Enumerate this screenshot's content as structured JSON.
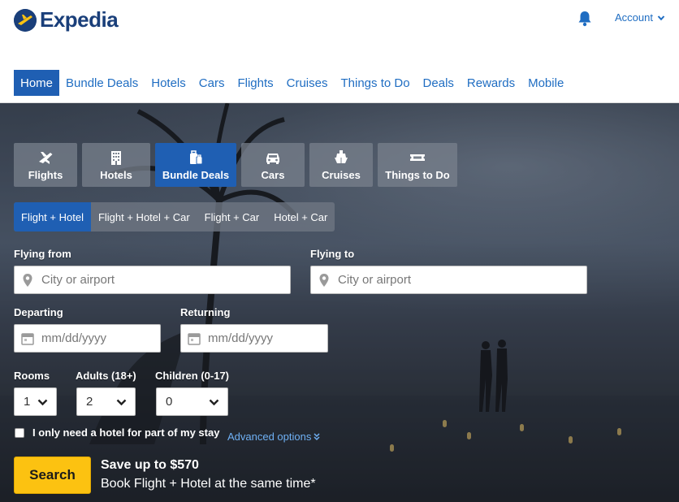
{
  "header": {
    "logo_text": "Expedia",
    "account_label": "Account"
  },
  "nav": {
    "items": [
      {
        "label": "Home"
      },
      {
        "label": "Bundle Deals"
      },
      {
        "label": "Hotels"
      },
      {
        "label": "Cars"
      },
      {
        "label": "Flights"
      },
      {
        "label": "Cruises"
      },
      {
        "label": "Things to Do"
      },
      {
        "label": "Deals"
      },
      {
        "label": "Rewards"
      },
      {
        "label": "Mobile"
      }
    ],
    "active": "Home"
  },
  "product_tabs": [
    {
      "label": "Flights",
      "icon": "plane-icon"
    },
    {
      "label": "Hotels",
      "icon": "hotel-building-icon"
    },
    {
      "label": "Bundle Deals",
      "icon": "bundle-luggage-icon"
    },
    {
      "label": "Cars",
      "icon": "car-icon"
    },
    {
      "label": "Cruises",
      "icon": "ship-icon"
    },
    {
      "label": "Things to Do",
      "icon": "ticket-icon"
    }
  ],
  "active_product_tab": "Bundle Deals",
  "sub_tabs": [
    {
      "label": "Flight + Hotel"
    },
    {
      "label": "Flight + Hotel + Car"
    },
    {
      "label": "Flight + Car"
    },
    {
      "label": "Hotel + Car"
    }
  ],
  "active_sub_tab": "Flight + Hotel",
  "form": {
    "flying_from_label": "Flying from",
    "flying_from_placeholder": "City or airport",
    "flying_to_label": "Flying to",
    "flying_to_placeholder": "City or airport",
    "departing_label": "Departing",
    "departing_placeholder": "mm/dd/yyyy",
    "returning_label": "Returning",
    "returning_placeholder": "mm/dd/yyyy",
    "rooms_label": "Rooms",
    "rooms_value": "1",
    "adults_label": "Adults (18+)",
    "adults_value": "2",
    "children_label": "Children (0-17)",
    "children_value": "0",
    "partial_stay_label": "I only need a hotel for part of my stay",
    "advanced_options_label": "Advanced options"
  },
  "search_button_label": "Search",
  "promo": {
    "title": "Save up to $570",
    "subtitle": "Book Flight + Hotel at the same time*"
  },
  "colors": {
    "brand_blue": "#1f5fb3",
    "link_blue": "#1f6dc2",
    "search_yellow": "#fcc211",
    "logo_navy": "#1a3f7a"
  }
}
